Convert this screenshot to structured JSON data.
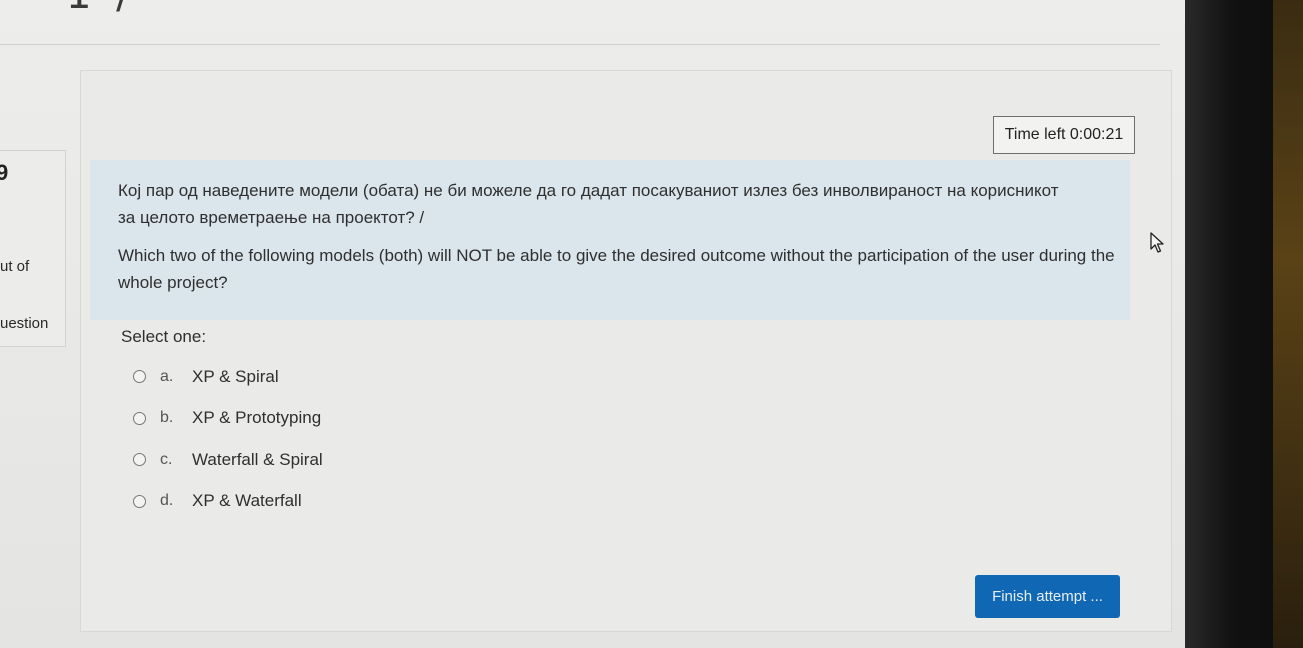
{
  "timer": {
    "text": "Time left 0:00:21"
  },
  "nav": {
    "glyph": "9",
    "out_of": "ut of",
    "question": "uestion"
  },
  "question": {
    "text_mk": "Кој пар од наведените модели (обата) не би можеле да го дадат посакуваниот излез без инволвираност на корисникот за целото времетраење на проектот? /",
    "text_en": "Which two of the following models (both) will NOT be able to give the desired outcome without the participation of the user during the whole project?",
    "select_label": "Select one:",
    "options": [
      {
        "letter": "a.",
        "text": "XP & Spiral"
      },
      {
        "letter": "b.",
        "text": "XP & Prototyping"
      },
      {
        "letter": "c.",
        "text": "Waterfall & Spiral"
      },
      {
        "letter": "d.",
        "text": "XP & Waterfall"
      }
    ]
  },
  "finish_button": {
    "label": "Finish attempt ..."
  },
  "icons": {
    "cursor": "mouse-pointer-icon"
  }
}
